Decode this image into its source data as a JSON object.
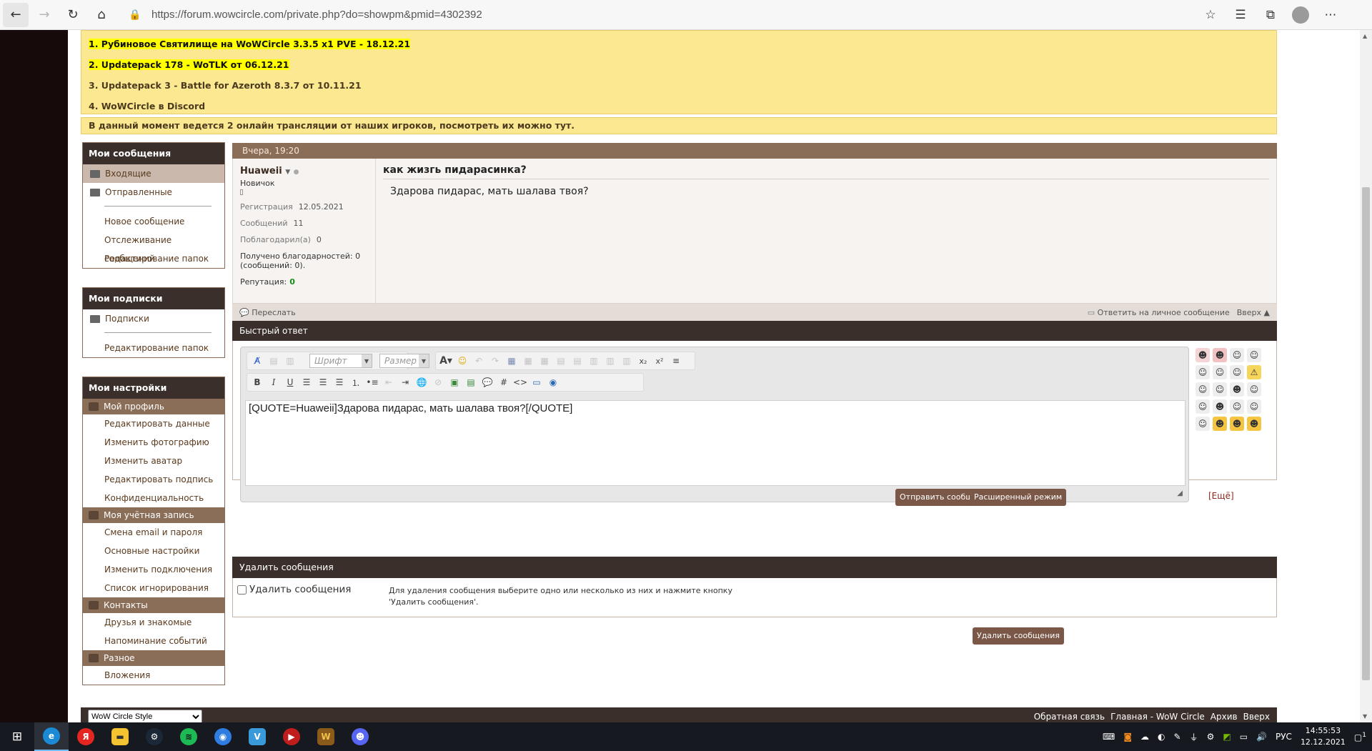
{
  "browser": {
    "url": "https://forum.wowcircle.com/private.php?do=showpm&pmid=4302392"
  },
  "news": [
    {
      "text": "1. Рубиновое Святилище на WoWCircle 3.3.5 x1 PVE - 18.12.21",
      "highlight": true
    },
    {
      "text": "2. Updatepack 178 - WoTLK от 06.12.21",
      "highlight": true
    },
    {
      "text": "3. Updatepack 3 - Battle for Azeroth 8.3.7 от 10.11.21",
      "highlight": false
    },
    {
      "text": "4. WoWCircle в Discord",
      "highlight": false
    }
  ],
  "broadcast": "В данный момент ведется 2 онлайн трансляции от наших игроков, посмотреть их можно тут.",
  "sidebar": {
    "messages": {
      "title": "Мои сообщения",
      "inbox": "Входящие",
      "sent": "Отправленные",
      "links": [
        "Новое сообщение",
        "Отслеживание сообщений",
        "Редактирование папок"
      ]
    },
    "subscriptions": {
      "title": "Мои подписки",
      "subs": "Подписки",
      "edit": "Редактирование папок"
    },
    "settings": {
      "title": "Мои настройки",
      "profile": {
        "label": "Мой профиль",
        "items": [
          "Редактировать данные",
          "Изменить фотографию",
          "Изменить аватар",
          "Редактировать подпись",
          "Конфиденциальность"
        ]
      },
      "account": {
        "label": "Моя учётная запись",
        "items": [
          "Смена email и пароля",
          "Основные настройки",
          "Изменить подключения",
          "Список игнорирования"
        ]
      },
      "contacts": {
        "label": "Контакты",
        "items": [
          "Друзья и знакомые",
          "Напоминание событий"
        ]
      },
      "misc": {
        "label": "Разное",
        "items": [
          "Вложения"
        ]
      }
    }
  },
  "pm": {
    "date": "Вчера, 19:20",
    "user": {
      "name": "Huaweii",
      "rank": "Новичок",
      "reg_label": "Регистрация",
      "reg_value": "12.05.2021",
      "posts_label": "Сообщений",
      "posts_value": "11",
      "thanked_label": "Поблагодарил(а)",
      "thanked_value": "0",
      "thanks_received": "Получено благодарностей: 0",
      "thanks_posts": "(сообщений: 0).",
      "rep_label": "Репутация:",
      "rep_value": "0"
    },
    "title": "как жизгь пидарасинка?",
    "text": "Здарова пидарас, мать шалава твоя?",
    "forward": "Переслать",
    "reply": "Ответить на личное сообщение",
    "top": "Вверх ▲"
  },
  "quick_reply": {
    "title": "Быстрый ответ",
    "font_placeholder": "Шрифт",
    "size_placeholder": "Размер",
    "content": "[QUOTE=Huaweii]Здарова пидарас, мать шалава твоя?[/QUOTE]",
    "more_smilies": "[Ещё]",
    "send": "Отправить сообщение",
    "advanced": "Расширенный режим"
  },
  "delete": {
    "title": "Удалить сообщения",
    "checkbox_label": "Удалить сообщения",
    "help_line1": "Для удаления сообщения выберите одно или несколько из них и нажмите кнопку",
    "help_line2": "'Удалить сообщения'.",
    "button": "Удалить сообщения"
  },
  "footer": {
    "style": "WoW Circle Style",
    "links": [
      "Обратная связь",
      "Главная - WoW Circle",
      "Архив",
      "Вверх"
    ]
  },
  "taskbar": {
    "lang": "РУС",
    "time": "14:55:53",
    "date": "12.12.2021",
    "notif": "1"
  },
  "colors": {
    "header_dark": "#3a2f2a",
    "header_brown": "#8b6e58",
    "news_bg": "#fde892",
    "rep_green": "#1a8a1a"
  }
}
